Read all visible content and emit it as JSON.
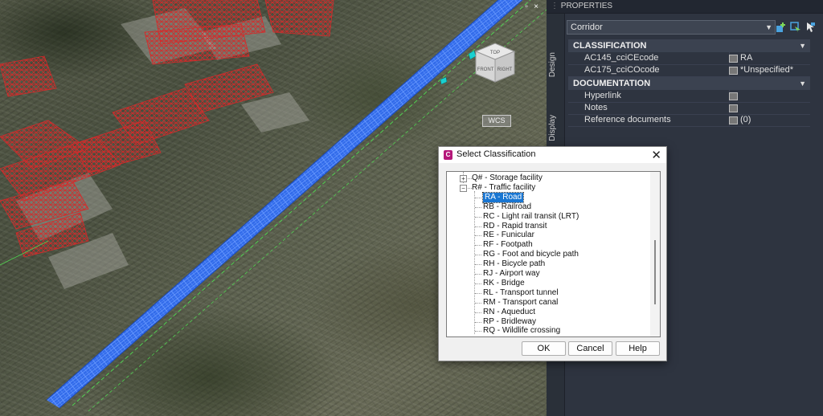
{
  "viewport": {
    "wcs_label": "WCS",
    "viewcube": {
      "top": "TOP",
      "front": "FRONT",
      "right": "RIGHT"
    }
  },
  "properties": {
    "title": "PROPERTIES",
    "side_tabs": [
      "Design",
      "Display"
    ],
    "object_type": "Corridor",
    "sections": [
      {
        "title": "CLASSIFICATION",
        "rows": [
          {
            "name": "AC145_cciCEcode",
            "value": "RA"
          },
          {
            "name": "AC175_cciCOcode",
            "value": "*Unspecified*"
          }
        ]
      },
      {
        "title": "DOCUMENTATION",
        "rows": [
          {
            "name": "Hyperlink",
            "value": ""
          },
          {
            "name": "Notes",
            "value": ""
          },
          {
            "name": "Reference documents",
            "value": "(0)"
          }
        ]
      }
    ]
  },
  "dialog": {
    "title": "Select Classification",
    "tree": [
      {
        "label": "Q# - Storage facility",
        "level": 0,
        "expander": "+"
      },
      {
        "label": "R# - Traffic facility",
        "level": 0,
        "expander": "-"
      },
      {
        "label": "RA - Road",
        "level": 1,
        "selected": true
      },
      {
        "label": "RB - Railroad",
        "level": 1
      },
      {
        "label": "RC - Light rail transit (LRT)",
        "level": 1
      },
      {
        "label": "RD - Rapid transit",
        "level": 1
      },
      {
        "label": "RE - Funicular",
        "level": 1
      },
      {
        "label": "RF - Footpath",
        "level": 1
      },
      {
        "label": "RG - Foot and bicycle path",
        "level": 1
      },
      {
        "label": "RH - Bicycle path",
        "level": 1
      },
      {
        "label": "RJ - Airport way",
        "level": 1
      },
      {
        "label": "RK - Bridge",
        "level": 1
      },
      {
        "label": "RL - Transport tunnel",
        "level": 1
      },
      {
        "label": "RM - Transport canal",
        "level": 1
      },
      {
        "label": "RN - Aqueduct",
        "level": 1
      },
      {
        "label": "RP - Bridleway",
        "level": 1
      },
      {
        "label": "RQ - Wildlife crossing",
        "level": 1
      }
    ],
    "buttons": {
      "ok": "OK",
      "cancel": "Cancel",
      "help": "Help"
    }
  },
  "colors": {
    "corridor": "#2f6cf2",
    "buildings_wire": "#d42a2a",
    "panel_bg": "#2e3440",
    "selection": "#1976d2",
    "app_icon": "#b5187a"
  }
}
